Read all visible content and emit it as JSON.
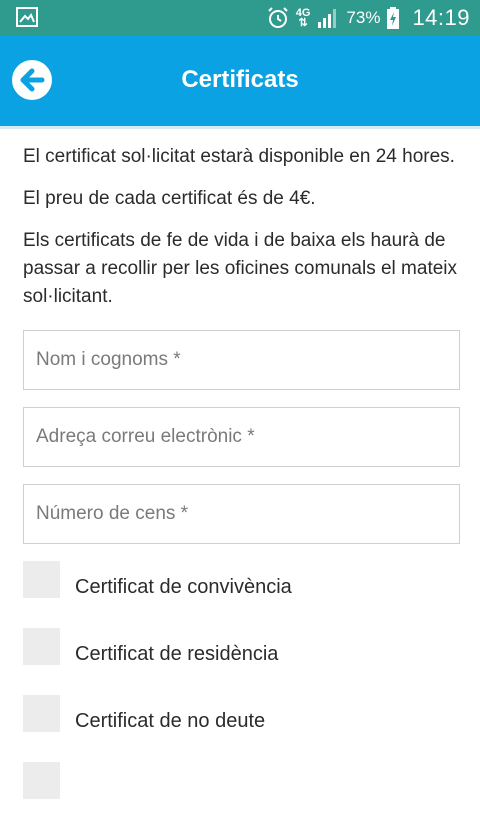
{
  "status_bar": {
    "network": "4G",
    "battery": "73%",
    "time": "14:19",
    "icons": [
      "image-icon",
      "alarm-icon",
      "signal-icon",
      "battery-charging-icon"
    ]
  },
  "header": {
    "title": "Certificats",
    "back_icon": "back-arrow-icon",
    "color": "#0aa2e3"
  },
  "info": {
    "para1": "El certificat sol·licitat estarà disponible en 24 hores.",
    "para2": "El preu de cada certificat és de 4€.",
    "para3": "Els certificats de fe de vida i de baixa els haurà de passar a recollir per les oficines comunals el mateix sol·licitant."
  },
  "form": {
    "name_placeholder": "Nom i cognoms *",
    "email_placeholder": "Adreça correu electrònic *",
    "census_placeholder": "Número de cens *"
  },
  "certificates": [
    {
      "label": "Certificat de convivència"
    },
    {
      "label": "Certificat de residència"
    },
    {
      "label": "Certificat de no deute"
    }
  ]
}
